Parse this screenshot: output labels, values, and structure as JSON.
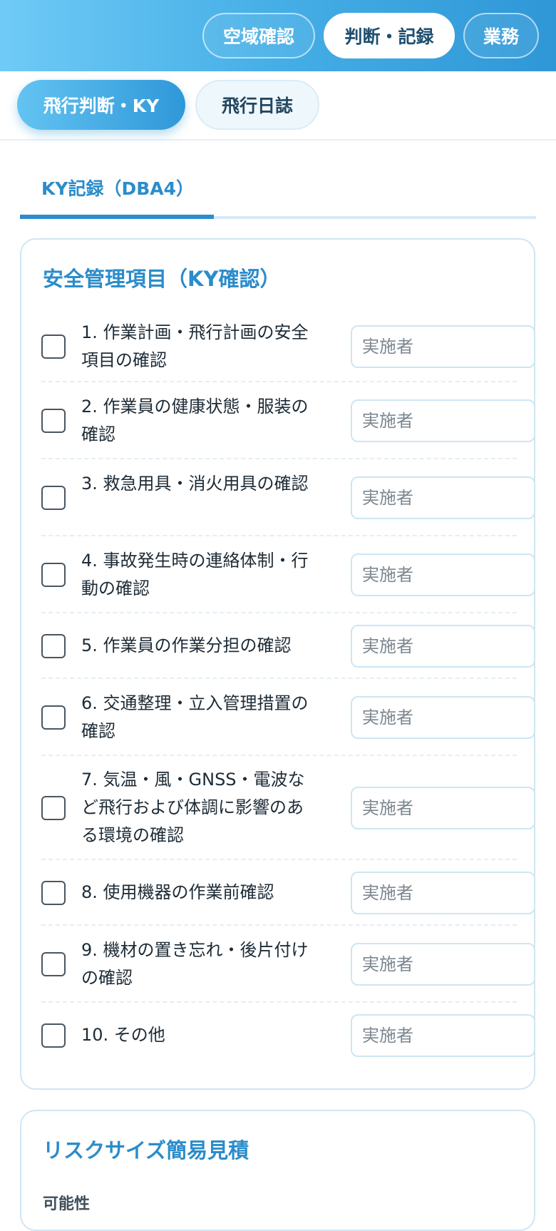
{
  "top_nav": [
    {
      "label": "空域確認",
      "active": false
    },
    {
      "label": "判断・記録",
      "active": true
    },
    {
      "label": "業務",
      "active": false
    }
  ],
  "sub_nav": [
    {
      "label": "飛行判断・KY",
      "active": true
    },
    {
      "label": "飛行日誌",
      "active": false
    }
  ],
  "tab": {
    "label": "KY記録（DBA4）"
  },
  "safety_card": {
    "title": "安全管理項目（KY確認）",
    "placeholder": "実施者",
    "items": [
      {
        "label": "1. 作業計画・飛行計画の安全項目の確認",
        "checked": false,
        "value": ""
      },
      {
        "label": "2. 作業員の健康状態・服装の確認",
        "checked": false,
        "value": ""
      },
      {
        "label": "3. 救急用具・消火用具の確認",
        "checked": false,
        "value": ""
      },
      {
        "label": "4. 事故発生時の連絡体制・行動の確認",
        "checked": false,
        "value": ""
      },
      {
        "label": "5. 作業員の作業分担の確認",
        "checked": false,
        "value": ""
      },
      {
        "label": "6. 交通整理・立入管理措置の確認",
        "checked": false,
        "value": ""
      },
      {
        "label": "7. 気温・風・GNSS・電波など飛行および体調に影響のある環境の確認",
        "checked": false,
        "value": ""
      },
      {
        "label": "8. 使用機器の作業前確認",
        "checked": false,
        "value": ""
      },
      {
        "label": "9. 機材の置き忘れ・後片付けの確認",
        "checked": false,
        "value": ""
      },
      {
        "label": "10. その他",
        "checked": false,
        "value": ""
      }
    ]
  },
  "risk_card": {
    "title": "リスクサイズ簡易見積",
    "likelihood_label": "可能性"
  }
}
